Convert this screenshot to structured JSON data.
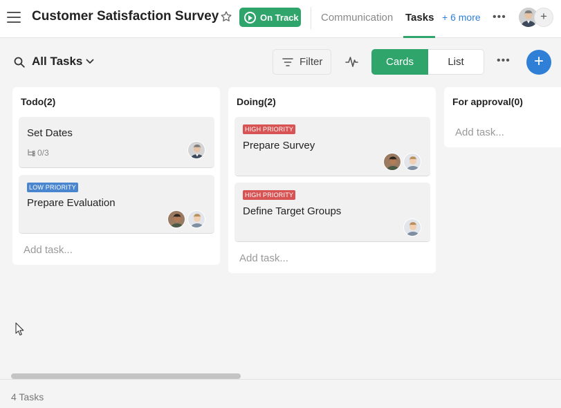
{
  "header": {
    "title": "Customer Satisfaction Survey",
    "status": {
      "label": "On Track",
      "color": "#2fa56b"
    },
    "tabs": [
      {
        "label": "Communication",
        "active": false
      },
      {
        "label": "Tasks",
        "active": true
      }
    ],
    "more_tabs": "+ 6 more",
    "icons": [
      "menu-icon",
      "star-icon",
      "play-circle-icon",
      "more-horizontal-icon",
      "plus-icon"
    ]
  },
  "toolbar": {
    "view_title": "All Tasks",
    "filter_label": "Filter",
    "view_modes": [
      {
        "label": "Cards",
        "active": true
      },
      {
        "label": "List",
        "active": false
      }
    ],
    "accent_color": "#2fa56b",
    "fab_color": "#2f7fd6",
    "icons": [
      "search-icon",
      "chevron-down-icon",
      "filter-icon",
      "activity-icon",
      "more-horizontal-icon",
      "plus-icon"
    ]
  },
  "board": {
    "add_task_placeholder": "Add task...",
    "priority_colors": {
      "HIGH PRIORITY": "#d85454",
      "LOW PRIORITY": "#4a86cf"
    },
    "columns": [
      {
        "title": "Todo(2)",
        "cards": [
          {
            "title": "Set Dates",
            "priority": "",
            "subtasks": "0/3",
            "assignees": [
              "man-gray-hair"
            ]
          },
          {
            "title": "Prepare Evaluation",
            "priority": "LOW PRIORITY",
            "subtasks": "",
            "assignees": [
              "man-dark-skin",
              "man-light-hair"
            ]
          }
        ]
      },
      {
        "title": "Doing(2)",
        "cards": [
          {
            "title": "Prepare Survey",
            "priority": "HIGH PRIORITY",
            "subtasks": "",
            "assignees": [
              "man-dark-skin",
              "man-light-hair"
            ]
          },
          {
            "title": "Define Target Groups",
            "priority": "HIGH PRIORITY",
            "subtasks": "",
            "assignees": [
              "man-light-hair"
            ]
          }
        ]
      },
      {
        "title": "For approval(0)",
        "cards": []
      }
    ]
  },
  "footer": {
    "task_count": "4 Tasks"
  }
}
